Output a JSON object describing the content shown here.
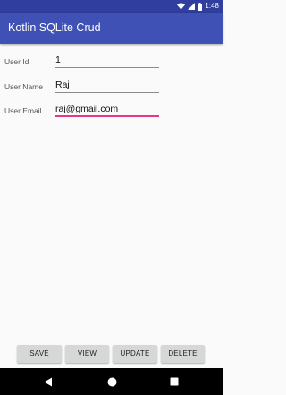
{
  "status_bar": {
    "time": "1:48",
    "icons": [
      "wifi-icon",
      "signal-icon",
      "battery-icon"
    ]
  },
  "app_bar": {
    "title": "Kotlin SQLite Crud",
    "color": "#3f51b5",
    "status_color": "#303f9f"
  },
  "form": {
    "user_id": {
      "label": "User Id",
      "value": "1"
    },
    "user_name": {
      "label": "User Name",
      "value": "Raj"
    },
    "user_email": {
      "label": "User Email",
      "value": "raj@gmail.com",
      "focused": true
    }
  },
  "buttons": {
    "save": "SAVE",
    "view": "VIEW",
    "update": "UPDATE",
    "delete": "DELETE"
  },
  "nav_bar": {
    "icons": [
      "back-icon",
      "home-icon",
      "recents-icon"
    ]
  },
  "colors": {
    "accent": "#e23b85",
    "button_bg": "#d6d7d7"
  }
}
